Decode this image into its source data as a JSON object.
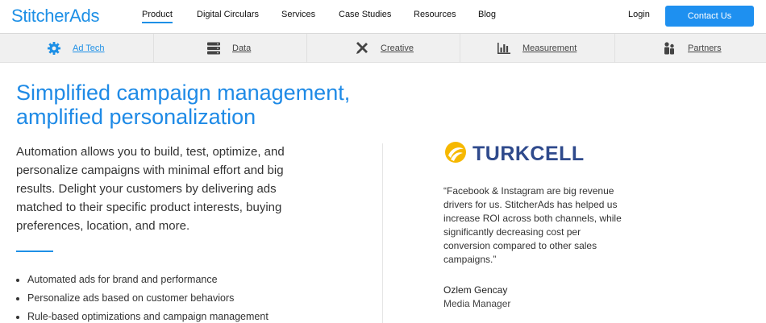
{
  "brand": {
    "logo_text": "StitcherAds"
  },
  "topnav": {
    "items": [
      {
        "label": "Product"
      },
      {
        "label": "Digital Circulars"
      },
      {
        "label": "Services"
      },
      {
        "label": "Case Studies"
      },
      {
        "label": "Resources"
      },
      {
        "label": "Blog"
      }
    ],
    "login": "Login",
    "contact": "Contact Us"
  },
  "subnav": {
    "items": [
      {
        "label": "Ad Tech",
        "icon": "gear-icon"
      },
      {
        "label": "Data",
        "icon": "server-icon"
      },
      {
        "label": "Creative",
        "icon": "tools-icon"
      },
      {
        "label": "Measurement",
        "icon": "bar-chart-icon"
      },
      {
        "label": "Partners",
        "icon": "people-icon"
      }
    ]
  },
  "hero": {
    "headline_line1": "Simplified campaign management,",
    "headline_line2": "amplified personalization",
    "intro": "Automation allows you to build, test, optimize, and personalize campaigns with minimal effort and big results. Delight your customers by delivering ads matched to their specific product interests, buying preferences, location, and more.",
    "bullets": [
      "Automated ads for brand and performance",
      "Personalize ads based on customer behaviors",
      "Rule-based optimizations and campaign management"
    ]
  },
  "testimonial": {
    "company": "TURKCELL",
    "quote": "“Facebook & Instagram are big revenue drivers for us. StitcherAds has helped us increase ROI across both channels, while significantly decreasing cost per conversion compared to other sales campaigns.”",
    "name": "Ozlem Gencay",
    "role": "Media Manager"
  },
  "colors": {
    "accent": "#1e90e6",
    "brand_navy": "#2f4a8c",
    "brand_yellow": "#f6b800"
  }
}
